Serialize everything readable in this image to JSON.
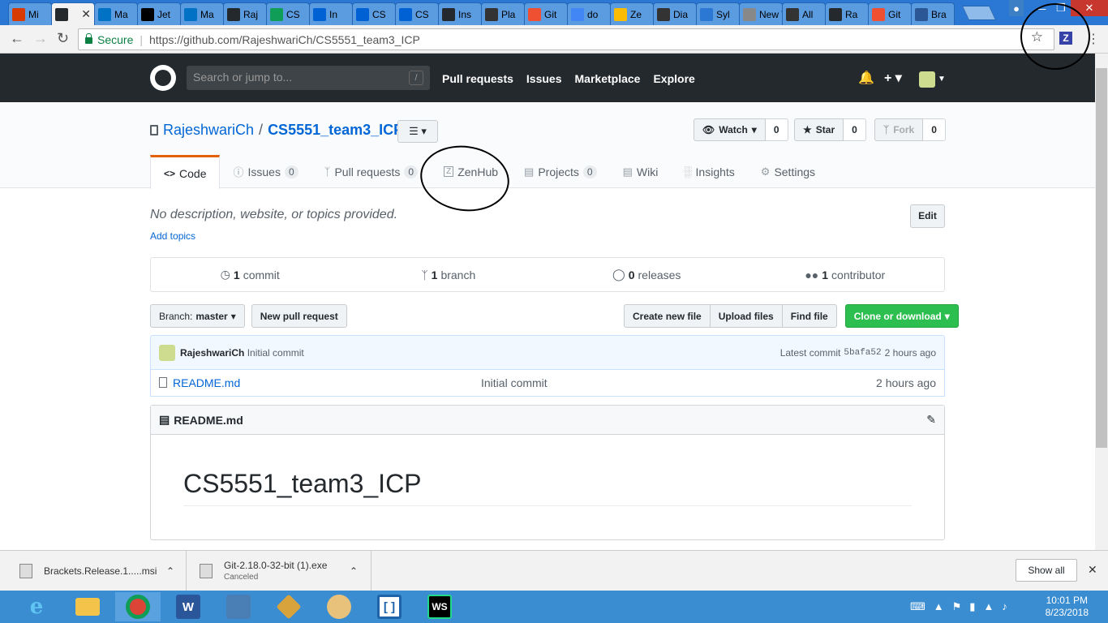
{
  "browser": {
    "tabs": [
      {
        "label": "Mi",
        "color": "#d83b01"
      },
      {
        "label": "",
        "color": "#24292e"
      },
      {
        "label": "Ma",
        "color": "#0072c6"
      },
      {
        "label": "Jet",
        "color": "#000000"
      },
      {
        "label": "Ma",
        "color": "#0072c6"
      },
      {
        "label": "Raj",
        "color": "#24292e"
      },
      {
        "label": "CS",
        "color": "#0f9d58"
      },
      {
        "label": "In",
        "color": "#0061d5"
      },
      {
        "label": "CS",
        "color": "#0061d5"
      },
      {
        "label": "CS",
        "color": "#0061d5"
      },
      {
        "label": "Ins",
        "color": "#24292e"
      },
      {
        "label": "Pla",
        "color": "#333333"
      },
      {
        "label": "Git",
        "color": "#f05032"
      },
      {
        "label": "do",
        "color": "#4285f4"
      },
      {
        "label": "Ze",
        "color": "#fbbc05"
      },
      {
        "label": "Dia",
        "color": "#333333"
      },
      {
        "label": "Syl",
        "color": "#2b78d4"
      },
      {
        "label": "New T",
        "color": "#888888"
      },
      {
        "label": "All",
        "color": "#333333"
      },
      {
        "label": "Ra",
        "color": "#24292e"
      },
      {
        "label": "Git",
        "color": "#f05032"
      },
      {
        "label": "Bra",
        "color": "#2b5797"
      }
    ],
    "secure_label": "Secure",
    "url": "https://github.com/RajeshwariCh/CS5551_team3_ICP",
    "ext_label": "Z"
  },
  "github": {
    "search_placeholder": "Search or jump to...",
    "search_key": "/",
    "nav": [
      "Pull requests",
      "Issues",
      "Marketplace",
      "Explore"
    ]
  },
  "repo": {
    "owner": "RajeshwariCh",
    "name": "CS5551_team3_ICP",
    "watch": {
      "label": "Watch",
      "count": "0"
    },
    "star": {
      "label": "Star",
      "count": "0"
    },
    "fork": {
      "label": "Fork",
      "count": "0"
    },
    "tabs": {
      "code": "Code",
      "issues": {
        "label": "Issues",
        "count": "0"
      },
      "pulls": {
        "label": "Pull requests",
        "count": "0"
      },
      "zenhub": "ZenHub",
      "projects": {
        "label": "Projects",
        "count": "0"
      },
      "wiki": "Wiki",
      "insights": "Insights",
      "settings": "Settings"
    },
    "description": "No description, website, or topics provided.",
    "add_topics": "Add topics",
    "edit": "Edit",
    "summary": {
      "commits": "1",
      "commits_label": "commit",
      "branches": "1",
      "branches_label": "branch",
      "releases": "0",
      "releases_label": "releases",
      "contributors": "1",
      "contributors_label": "contributor"
    },
    "branch_label": "Branch:",
    "branch": "master",
    "new_pr": "New pull request",
    "create_file": "Create new file",
    "upload_files": "Upload files",
    "find_file": "Find file",
    "clone": "Clone or download",
    "commit": {
      "author": "RajeshwariCh",
      "message": "Initial commit",
      "latest_label": "Latest commit",
      "sha": "5bafa52",
      "time": "2 hours ago"
    },
    "files": [
      {
        "name": "README.md",
        "message": "Initial commit",
        "time": "2 hours ago"
      }
    ],
    "readme": {
      "title": "README.md",
      "h1": "CS5551_team3_ICP"
    }
  },
  "downloads": [
    {
      "name": "Brackets.Release.1.....msi",
      "status": ""
    },
    {
      "name": "Git-2.18.0-32-bit (1).exe",
      "status": "Canceled"
    }
  ],
  "show_all": "Show all",
  "clock": {
    "time": "10:01 PM",
    "date": "8/23/2018"
  }
}
